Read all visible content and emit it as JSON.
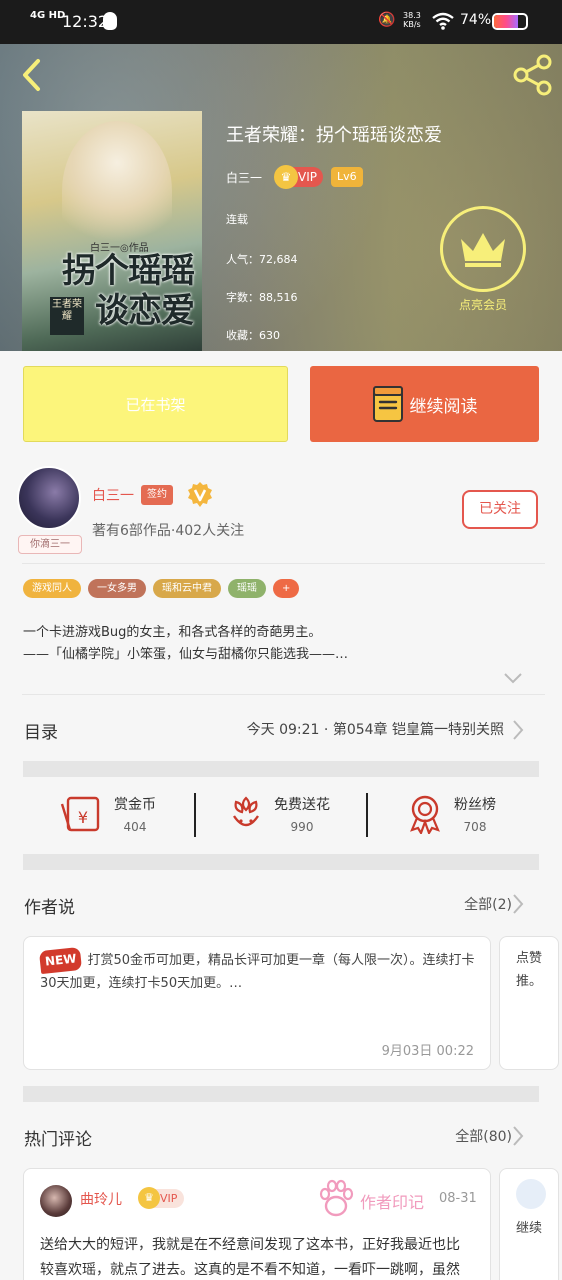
{
  "status_bar": {
    "network": "4G HD",
    "time": "12:32",
    "speed_value": "38.3",
    "speed_unit": "KB/s",
    "battery": "74%"
  },
  "book": {
    "title": "王者荣耀：拐个瑶瑶谈恋爱",
    "author": "白三一",
    "vip_label": "VIP",
    "level": "Lv6",
    "status": "连载",
    "popularity": "人气：72,684",
    "words": "字数：88,516",
    "favorites": "收藏：630",
    "cover": {
      "small_text": "白三一◎作品",
      "title_line1": "拐个瑶瑶",
      "title_line2": "谈恋爱",
      "badge": "王者荣耀"
    }
  },
  "member": {
    "label": "点亮会员"
  },
  "actions": {
    "shelf_label": "已在书架",
    "read_label": "继续阅读"
  },
  "author_card": {
    "name": "白三一",
    "sign_badge": "签约",
    "avatar_tag": "你滴三一",
    "stats": "著有6部作品·402人关注",
    "follow_label": "已关注"
  },
  "tags": [
    {
      "label": "游戏同人",
      "color": "#f0b33e"
    },
    {
      "label": "一女多男",
      "color": "#c0735a"
    },
    {
      "label": "瑶和云中君",
      "color": "#d8a84a"
    },
    {
      "label": "瑶瑶",
      "color": "#8fb26b"
    },
    {
      "label": "+",
      "color": "#ee6a45"
    }
  ],
  "intro": {
    "line1": "一个卡进游戏Bug的女主，和各式各样的奇葩男主。",
    "line2": "——「仙橘学院」小笨蛋，仙女与甜橘你只能选我——…"
  },
  "toc": {
    "title": "目录",
    "latest": "今天  09:21 · 第054章 铠皇篇一特别关照"
  },
  "rewards": [
    {
      "label": "赏金币",
      "value": "404"
    },
    {
      "label": "免费送花",
      "value": "990"
    },
    {
      "label": "粉丝榜",
      "value": "708"
    }
  ],
  "author_says": {
    "title": "作者说",
    "all_link": "全部(2)",
    "new_badge": "NEW",
    "text": "打赏50金币可加更，精品长评可加更一章（每人限一次）。连续打卡30天加更，连续打卡50天加更。…",
    "date": "9月03日  00:22",
    "peek_text": "点赞推。"
  },
  "hot_comments": {
    "title": "热门评论",
    "all_link": "全部(80)",
    "user": "曲玲儿",
    "vip_label": "VIP",
    "mark": "作者印记",
    "date": "08-31",
    "body": "送给大大的短评，我就是在不经意间发现了这本书，正好我最近也比较喜欢瑶，就点了进去。这真的是不看不知道，一看吓一跳啊，虽然",
    "peek_text": "继续"
  },
  "colors": {
    "accent": "#e4574e",
    "read_button": "#ea6642",
    "shelf_button": "#fcf57b",
    "member_yellow": "#f7ef7a"
  }
}
